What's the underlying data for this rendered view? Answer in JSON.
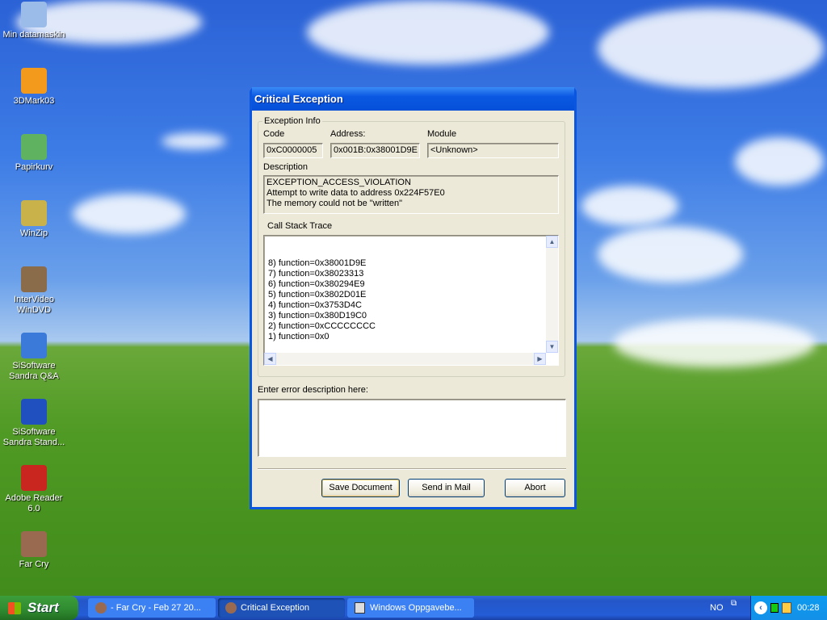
{
  "desktop": {
    "icons": [
      {
        "label": "Min datamaskin",
        "icon": "computer-icon",
        "color": "#9bbbe8"
      },
      {
        "label": "3DMark03",
        "icon": "3dmark-icon",
        "color": "#f39a1c"
      },
      {
        "label": "Papirkurv",
        "icon": "recycle-bin-icon",
        "color": "#5fb25f"
      },
      {
        "label": "WinZip",
        "icon": "winzip-icon",
        "color": "#c9b24a"
      },
      {
        "label": "InterVideo WinDVD",
        "icon": "windvd-icon",
        "color": "#8a6b4a"
      },
      {
        "label": "SiSoftware Sandra Q&A",
        "icon": "internet-explorer-icon",
        "color": "#3b7ad8"
      },
      {
        "label": "SiSoftware Sandra Stand...",
        "icon": "sandra-info-icon",
        "color": "#2050c0"
      },
      {
        "label": "Adobe Reader 6.0",
        "icon": "adobe-reader-icon",
        "color": "#c8261e"
      },
      {
        "label": "Far Cry",
        "icon": "far-cry-icon",
        "color": "#9a6a50"
      }
    ]
  },
  "dialog": {
    "title": "Critical Exception",
    "group_label": "Exception Info",
    "code_label": "Code",
    "code_value": "0xC0000005",
    "address_label": "Address:",
    "address_value": "0x001B:0x38001D9E",
    "module_label": "Module",
    "module_value": "<Unknown>",
    "description_label": "Description",
    "description_value": "EXCEPTION_ACCESS_VIOLATION\nAttempt to write data to address 0x224F57E0\nThe memory could not be \"written\"",
    "callstack_label": "Call Stack Trace",
    "callstack_value": "8) function=0x38001D9E\n7) function=0x38023313\n6) function=0x380294E9\n5) function=0x3802D01E\n4) function=0x3753D4C\n3) function=0x380D19C0\n2) function=0xCCCCCCCC\n1) function=0x0",
    "error_desc_label": "Enter error description here:",
    "error_desc_value": "",
    "buttons": {
      "save": "Save Document",
      "mail": "Send in Mail",
      "abort": "Abort"
    }
  },
  "taskbar": {
    "start": "Start",
    "tasks": [
      "- Far Cry - Feb 27 20...",
      "Critical Exception",
      "Windows Oppgavebe..."
    ],
    "language": "NO",
    "clock": "00:28"
  }
}
